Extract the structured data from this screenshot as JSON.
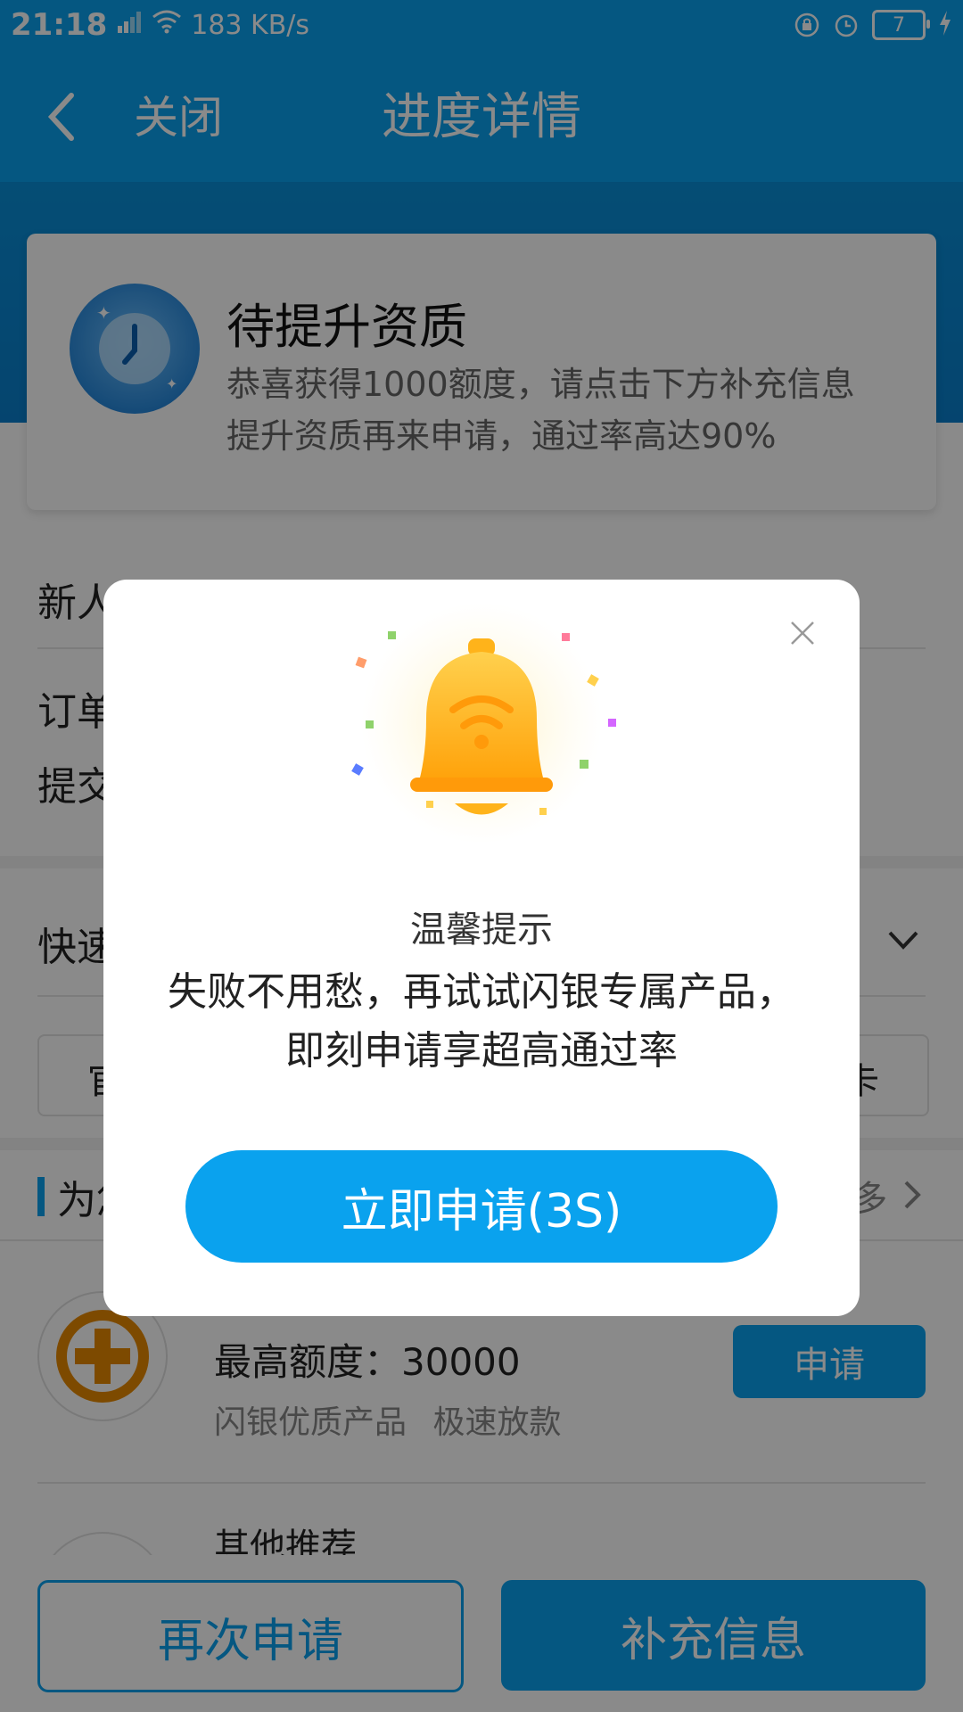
{
  "status_bar": {
    "time": "21:18",
    "network": "4G",
    "speed": "183 KB/s",
    "battery": "7"
  },
  "nav": {
    "close_label": "关闭",
    "title": "进度详情"
  },
  "status_card": {
    "title": "待提升资质",
    "line1": "恭喜获得1000额度，请点击下方补充信息",
    "line2": "提升资质再来申请，通过率高达90%"
  },
  "background_rows": {
    "newbie": "新人",
    "order": "订单",
    "submit": "提交",
    "express": "快速",
    "rec_title": "为您",
    "rec_more": "多",
    "tab_left": "官",
    "tab_right": "卡"
  },
  "product": {
    "limit": "最高额度：30000",
    "tags": "闪银优质产品 极速放款",
    "apply": "申请"
  },
  "other_recommend": "其他推荐",
  "bottom": {
    "reapply": "再次申请",
    "supplement": "补充信息"
  },
  "modal": {
    "heading": "温馨提示",
    "line1": "失败不用愁，再试试闪银专属产品，",
    "line2": "即刻申请享超高通过率",
    "button": "立即申请(3S)"
  },
  "colors": {
    "brand": "#0aa2ee",
    "bell": "#ffb31a"
  }
}
